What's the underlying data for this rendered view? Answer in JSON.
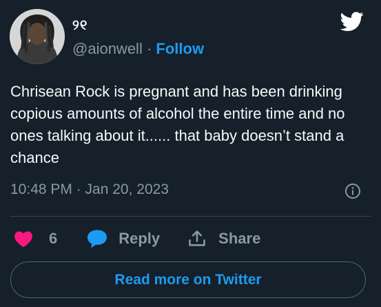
{
  "author": {
    "display_name": "୨୧",
    "handle": "@aionwell",
    "separator": "·",
    "follow_label": "Follow"
  },
  "tweet": {
    "text": "Chrisean Rock is pregnant and has been drinking copious amounts of alcohol the entire time and no ones talking about it...... that baby doesn’t stand a chance",
    "timestamp": "10:48 PM · Jan 20, 2023"
  },
  "actions": {
    "like_count": "6",
    "reply_label": "Reply",
    "share_label": "Share"
  },
  "read_more_label": "Read more on Twitter",
  "colors": {
    "background": "#15202b",
    "accent": "#1d9bf0",
    "like": "#f91880",
    "muted": "#8b98a5",
    "text": "#f7f9f9"
  },
  "icons": [
    "avatar-image",
    "twitter-bird-icon",
    "info-icon",
    "heart-icon",
    "reply-bubble-icon",
    "share-icon"
  ]
}
